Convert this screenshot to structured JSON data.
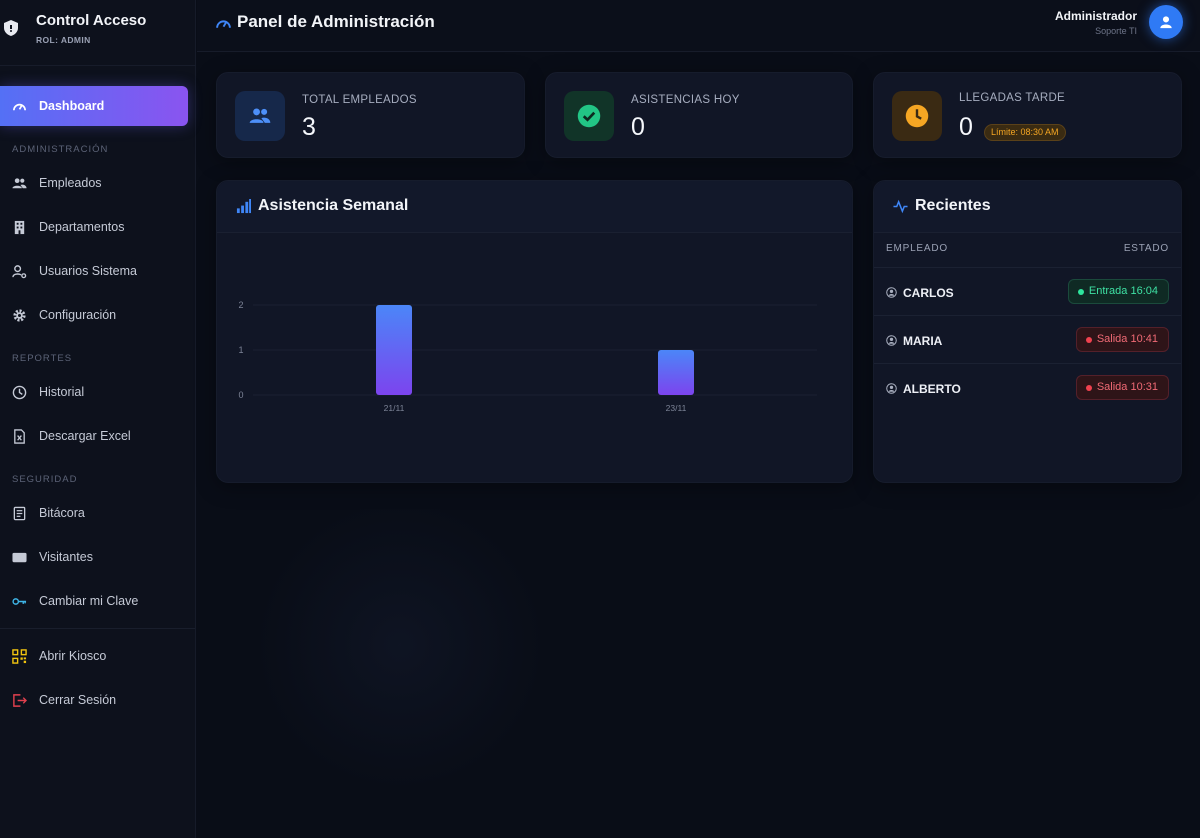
{
  "brand": {
    "title": "Control Acceso",
    "role": "ROL: ADMIN"
  },
  "nav": {
    "dashboard": "Dashboard",
    "section_admin": "ADMINISTRACIÓN",
    "empleados": "Empleados",
    "departamentos": "Departamentos",
    "usuarios": "Usuarios Sistema",
    "configuracion": "Configuración",
    "section_reportes": "REPORTES",
    "historial": "Historial",
    "excel": "Descargar Excel",
    "section_seguridad": "SEGURIDAD",
    "bitacora": "Bitácora",
    "visitantes": "Visitantes",
    "clave": "Cambiar mi Clave",
    "kiosco": "Abrir Kiosco",
    "cerrar": "Cerrar Sesión"
  },
  "header": {
    "title": "Panel de Administración",
    "user_name": "Administrador",
    "user_role": "Soporte TI"
  },
  "stats": {
    "empleados": {
      "label": "TOTAL EMPLEADOS",
      "value": "3"
    },
    "asistencias": {
      "label": "ASISTENCIAS HOY",
      "value": "0"
    },
    "tarde": {
      "label": "LLEGADAS TARDE",
      "value": "0",
      "badge": "Límite: 08:30 AM"
    }
  },
  "weekly": {
    "title": "Asistencia Semanal"
  },
  "chart_data": {
    "type": "bar",
    "categories": [
      "21/11",
      "23/11"
    ],
    "values": [
      2,
      1
    ],
    "ylim": [
      0,
      2
    ],
    "yticks": [
      0,
      1,
      2
    ],
    "grid": true
  },
  "recent": {
    "title": "Recientes",
    "col_employee": "EMPLEADO",
    "col_status": "ESTADO",
    "rows": [
      {
        "name": "CARLOS",
        "status": "Entrada 16:04",
        "kind": "in"
      },
      {
        "name": "MARIA",
        "status": "Salida 10:41",
        "kind": "out"
      },
      {
        "name": "ALBERTO",
        "status": "Salida 10:31",
        "kind": "out"
      }
    ]
  },
  "colors": {
    "accent_blue": "#2f7af5",
    "accent_purple": "#8a54f0",
    "success": "#2ee59d",
    "danger": "#f0414f",
    "warning": "#f5a623"
  }
}
